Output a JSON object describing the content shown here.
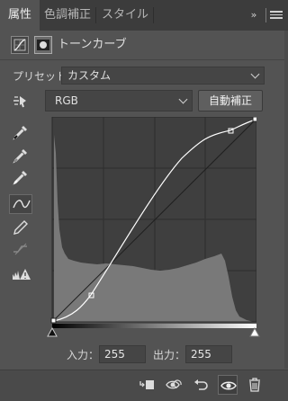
{
  "tabs": [
    {
      "label": "属性",
      "active": true
    },
    {
      "label": "色調補正",
      "active": false
    },
    {
      "label": "スタイル",
      "active": false
    }
  ],
  "tab_controls": {
    "collapse": "»"
  },
  "header": {
    "title": "トーンカーブ"
  },
  "preset": {
    "label": "プリセット：",
    "value": "カスタム"
  },
  "channel": {
    "value": "RGB"
  },
  "auto_button": "自動補正",
  "input": {
    "label": "入力：",
    "value": "255"
  },
  "output": {
    "label": "出力：",
    "value": "255"
  },
  "icons": {
    "tools": [
      "targeted-adjust-icon",
      "black-eyedropper-icon",
      "gray-eyedropper-icon",
      "white-eyedropper-icon",
      "curve-points-icon",
      "pencil-icon",
      "smooth-curve-icon",
      "clipping-warning-icon"
    ],
    "bottom": [
      "clip-to-layer-icon",
      "view-previous-state-icon",
      "reset-icon",
      "visibility-eye-icon",
      "trash-icon"
    ]
  },
  "colors": {
    "panel_bg": "#535353",
    "tab_bg": "#3c3c3c",
    "graph_bg": "#3f3f3f",
    "histogram": "#797979",
    "curve": "#ffffff"
  }
}
